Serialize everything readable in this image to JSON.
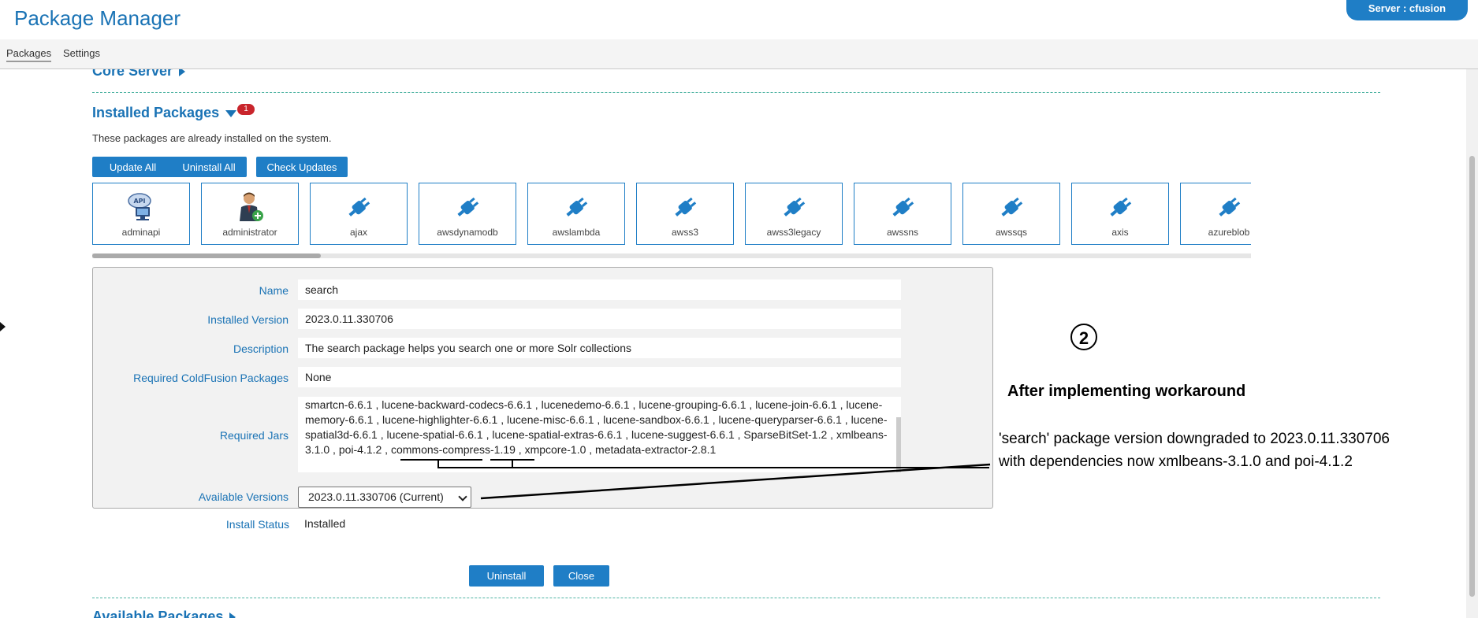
{
  "app": {
    "title": "Package Manager",
    "server": "Server : cfusion"
  },
  "tabs": [
    {
      "label": "Packages",
      "active": true
    },
    {
      "label": "Settings",
      "active": false
    }
  ],
  "sections": {
    "core": {
      "title": "Core Server"
    },
    "installed": {
      "title": "Installed Packages",
      "badge": "1",
      "description": "These packages are already installed on the system.",
      "buttons": {
        "update_all": "Update All",
        "uninstall_all": "Uninstall All",
        "check_updates": "Check Updates"
      },
      "packages": [
        {
          "name": "adminapi",
          "icon": "adminapi-icon"
        },
        {
          "name": "administrator",
          "icon": "administrator-icon"
        },
        {
          "name": "ajax",
          "icon": "plug-icon"
        },
        {
          "name": "awsdynamodb",
          "icon": "plug-icon"
        },
        {
          "name": "awslambda",
          "icon": "plug-icon"
        },
        {
          "name": "awss3",
          "icon": "plug-icon"
        },
        {
          "name": "awss3legacy",
          "icon": "plug-icon"
        },
        {
          "name": "awssns",
          "icon": "plug-icon"
        },
        {
          "name": "awssqs",
          "icon": "plug-icon"
        },
        {
          "name": "axis",
          "icon": "plug-icon"
        },
        {
          "name": "azureblob",
          "icon": "plug-icon"
        }
      ]
    },
    "available": {
      "title": "Available Packages"
    }
  },
  "details": {
    "labels": {
      "name": "Name",
      "installed_version": "Installed Version",
      "description": "Description",
      "required_cf_packages": "Required ColdFusion Packages",
      "required_jars": "Required Jars",
      "available_versions": "Available Versions",
      "install_status": "Install Status"
    },
    "values": {
      "name": "search",
      "installed_version": "2023.0.11.330706",
      "description": "The search package helps you search one or more Solr collections",
      "required_cf_packages": "None",
      "jars_part1": "smartcn-6.6.1 , lucene-backward-codecs-6.6.1 , lucenedemo-6.6.1 , lucene-grouping-6.6.1 , lucene-join-6.6.1 , lucene-memory-6.6.1 , lucene-highlighter-6.6.1 , lucene-misc-6.6.1 , lucene-sandbox-6.6.1 , lucene-queryparser-6.6.1 , lucene-spatial3d-6.6.1 , lucene-spatial-6.6.1 , lucene-spatial-extras-6.6.1 , lucene-suggest-6.6.1 , SparseBitSet-1.2 , ",
      "jars_xmlbeans": "xmlbeans-3.1.0",
      "jars_sep": " , ",
      "jars_poi": "poi-4.1.2",
      "jars_part2": " , commons-compress-1.19 , xmpcore-1.0 , metadata-extractor-2.8.1",
      "available_version_selected": "2023.0.11.330706 (Current)",
      "install_status": "Installed"
    },
    "buttons": {
      "uninstall": "Uninstall",
      "close": "Close"
    }
  },
  "annotation": {
    "number": "2",
    "title": "After implementing workaround",
    "line1": "'search' package version downgraded to 2023.0.11.330706",
    "line2": "with dependencies now xmlbeans-3.1.0 and poi-4.1.2"
  },
  "colors": {
    "accent": "#1f7ec6",
    "heading": "#1a73b5",
    "badge": "#c9252c",
    "divider": "#4fb4a3"
  }
}
